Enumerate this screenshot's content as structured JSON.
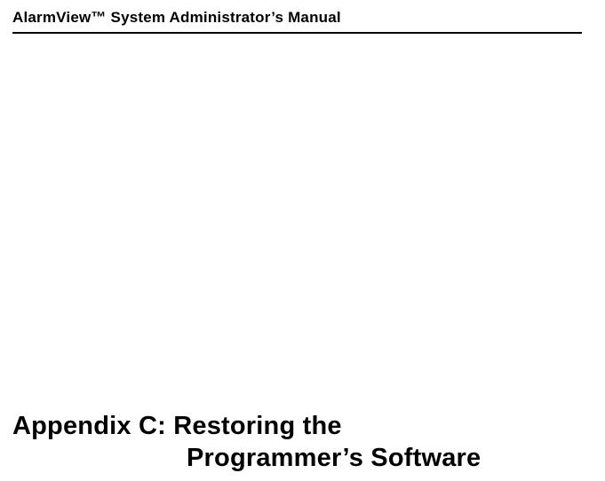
{
  "header": {
    "running_title": "AlarmView™ System Administrator’s Manual"
  },
  "appendix": {
    "line1": "Appendix C: Restoring the",
    "line2": "Programmer’s Software"
  }
}
